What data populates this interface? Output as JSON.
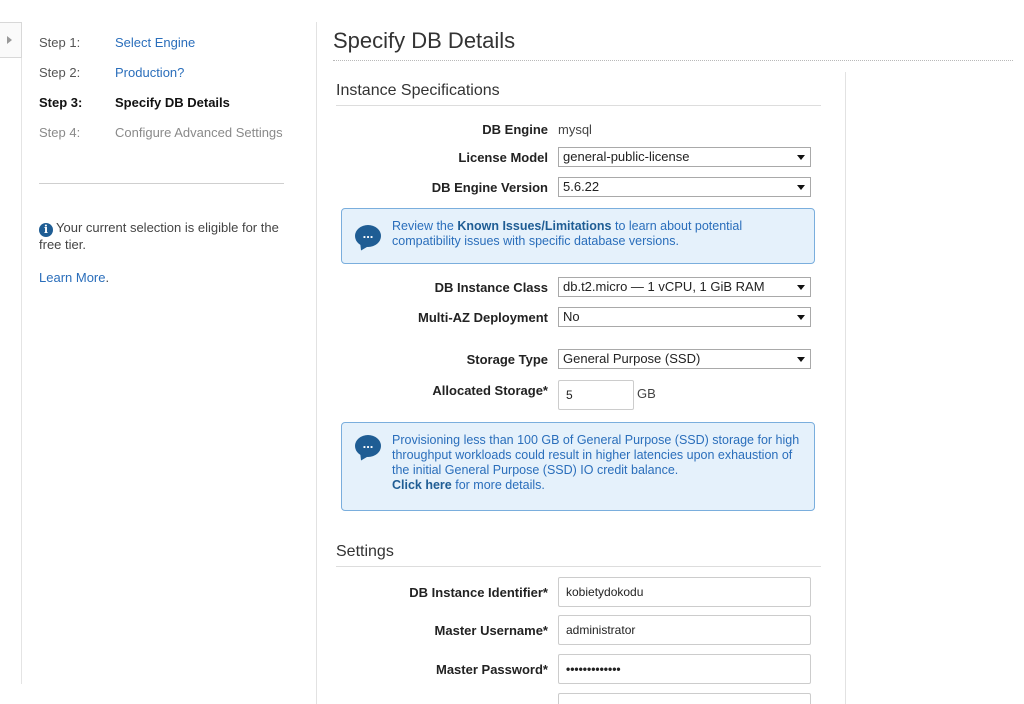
{
  "wizard": {
    "steps": [
      {
        "number": "Step 1:",
        "name": "Select Engine"
      },
      {
        "number": "Step 2:",
        "name": "Production?"
      },
      {
        "number": "Step 3:",
        "name": "Specify DB Details"
      },
      {
        "number": "Step 4:",
        "name": "Configure Advanced Settings"
      }
    ],
    "free_tier_note": "Your current selection is eligible for the free tier.",
    "learn_more": "Learn More",
    "learn_more_period": "."
  },
  "page": {
    "title": "Specify DB Details"
  },
  "instance_specs": {
    "heading": "Instance Specifications",
    "db_engine": {
      "label": "DB Engine",
      "value": "mysql"
    },
    "license_model": {
      "label": "License Model",
      "value": "general-public-license"
    },
    "engine_version": {
      "label": "DB Engine Version",
      "value": "5.6.22"
    },
    "known_issues_notice": {
      "prefix": "Review the ",
      "link": "Known Issues/Limitations",
      "suffix": " to learn about potential compatibility issues with specific database versions."
    },
    "instance_class": {
      "label": "DB Instance Class",
      "value": "db.t2.micro — 1 vCPU, 1 GiB RAM"
    },
    "multi_az": {
      "label": "Multi-AZ Deployment",
      "value": "No"
    },
    "storage_type": {
      "label": "Storage Type",
      "value": "General Purpose (SSD)"
    },
    "allocated_storage": {
      "label": "Allocated Storage*",
      "value": "5",
      "unit": "GB"
    },
    "storage_notice": {
      "text": "Provisioning less than 100 GB of General Purpose (SSD) storage for high throughput workloads could result in higher latencies upon exhaustion of the initial General Purpose (SSD) IO credit balance.",
      "link": "Click here",
      "suffix": " for more details."
    }
  },
  "settings": {
    "heading": "Settings",
    "instance_identifier": {
      "label": "DB Instance Identifier*",
      "value": "kobietydokodu"
    },
    "master_username": {
      "label": "Master Username*",
      "value": "administrator"
    },
    "master_password": {
      "label": "Master Password*",
      "value": "•••••••••••••"
    }
  },
  "icons": {
    "toggle": "expand-arrow-icon",
    "info": "info-circle-icon",
    "notice": "speech-bubble-icon"
  }
}
